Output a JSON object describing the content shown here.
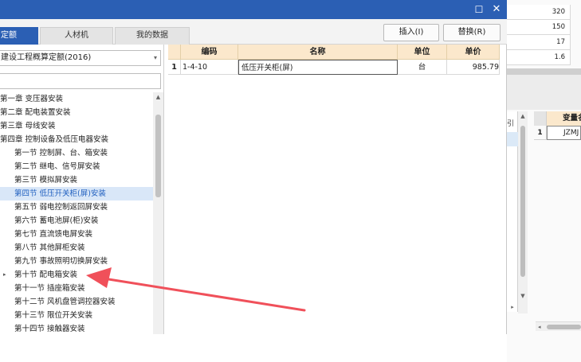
{
  "window": {
    "max_icon": "☐",
    "close_icon": "✕"
  },
  "tabs": [
    {
      "label": "定额"
    },
    {
      "label": "人材机"
    },
    {
      "label": "我的数据"
    }
  ],
  "toolbar": {
    "insert_label": "插入(I)",
    "replace_label": "替换(R)"
  },
  "left": {
    "library_select": "建设工程概算定额(2016)",
    "search": {
      "value": "",
      "placeholder": ""
    },
    "tree": [
      {
        "label": "第一章 变压器安装",
        "level": 1
      },
      {
        "label": "第二章 配电装置安装",
        "level": 1
      },
      {
        "label": "第三章 母线安装",
        "level": 1
      },
      {
        "label": "第四章 控制设备及低压电器安装",
        "level": 1
      },
      {
        "label": "第一节 控制屏、台、箱安装",
        "level": 2
      },
      {
        "label": "第二节 继电、信号屏安装",
        "level": 2
      },
      {
        "label": "第三节 模拟屏安装",
        "level": 2
      },
      {
        "label": "第四节 低压开关柜(屏)安装",
        "level": 2,
        "selected": true
      },
      {
        "label": "第五节 弱电控制返回屏安装",
        "level": 2
      },
      {
        "label": "第六节 蓄电池屏(柜)安装",
        "level": 2
      },
      {
        "label": "第七节 直流馈电屏安装",
        "level": 2
      },
      {
        "label": "第八节 其他屏柜安装",
        "level": 2
      },
      {
        "label": "第九节 事故照明切换屏安装",
        "level": 2
      },
      {
        "label": "第十节 配电箱安装",
        "level": 2,
        "expandable": true
      },
      {
        "label": "第十一节 插座箱安装",
        "level": 2
      },
      {
        "label": "第十二节 风机盘管调控器安装",
        "level": 2
      },
      {
        "label": "第十三节 限位开关安装",
        "level": 2
      },
      {
        "label": "第十四节 接触器安装",
        "level": 2
      }
    ]
  },
  "table": {
    "headers": [
      "",
      "编码",
      "名称",
      "单位",
      "单价"
    ],
    "rows": [
      {
        "num": "1",
        "code": "1-4-10",
        "name": "低压开关柜(屏)",
        "unit": "台",
        "price": "985.79"
      }
    ]
  },
  "background": {
    "cells": [
      "320",
      "150",
      "17",
      "1.6"
    ],
    "grid_header": "变量名",
    "left_col_header": "引",
    "row_num": "1",
    "row_value": "JZMJ"
  },
  "colors": {
    "title_bar": "#2b5fb4",
    "selected_tree": "#1f5fbf",
    "header_bg": "#fbe8cc",
    "annotation_arrow": "#f0505a"
  }
}
